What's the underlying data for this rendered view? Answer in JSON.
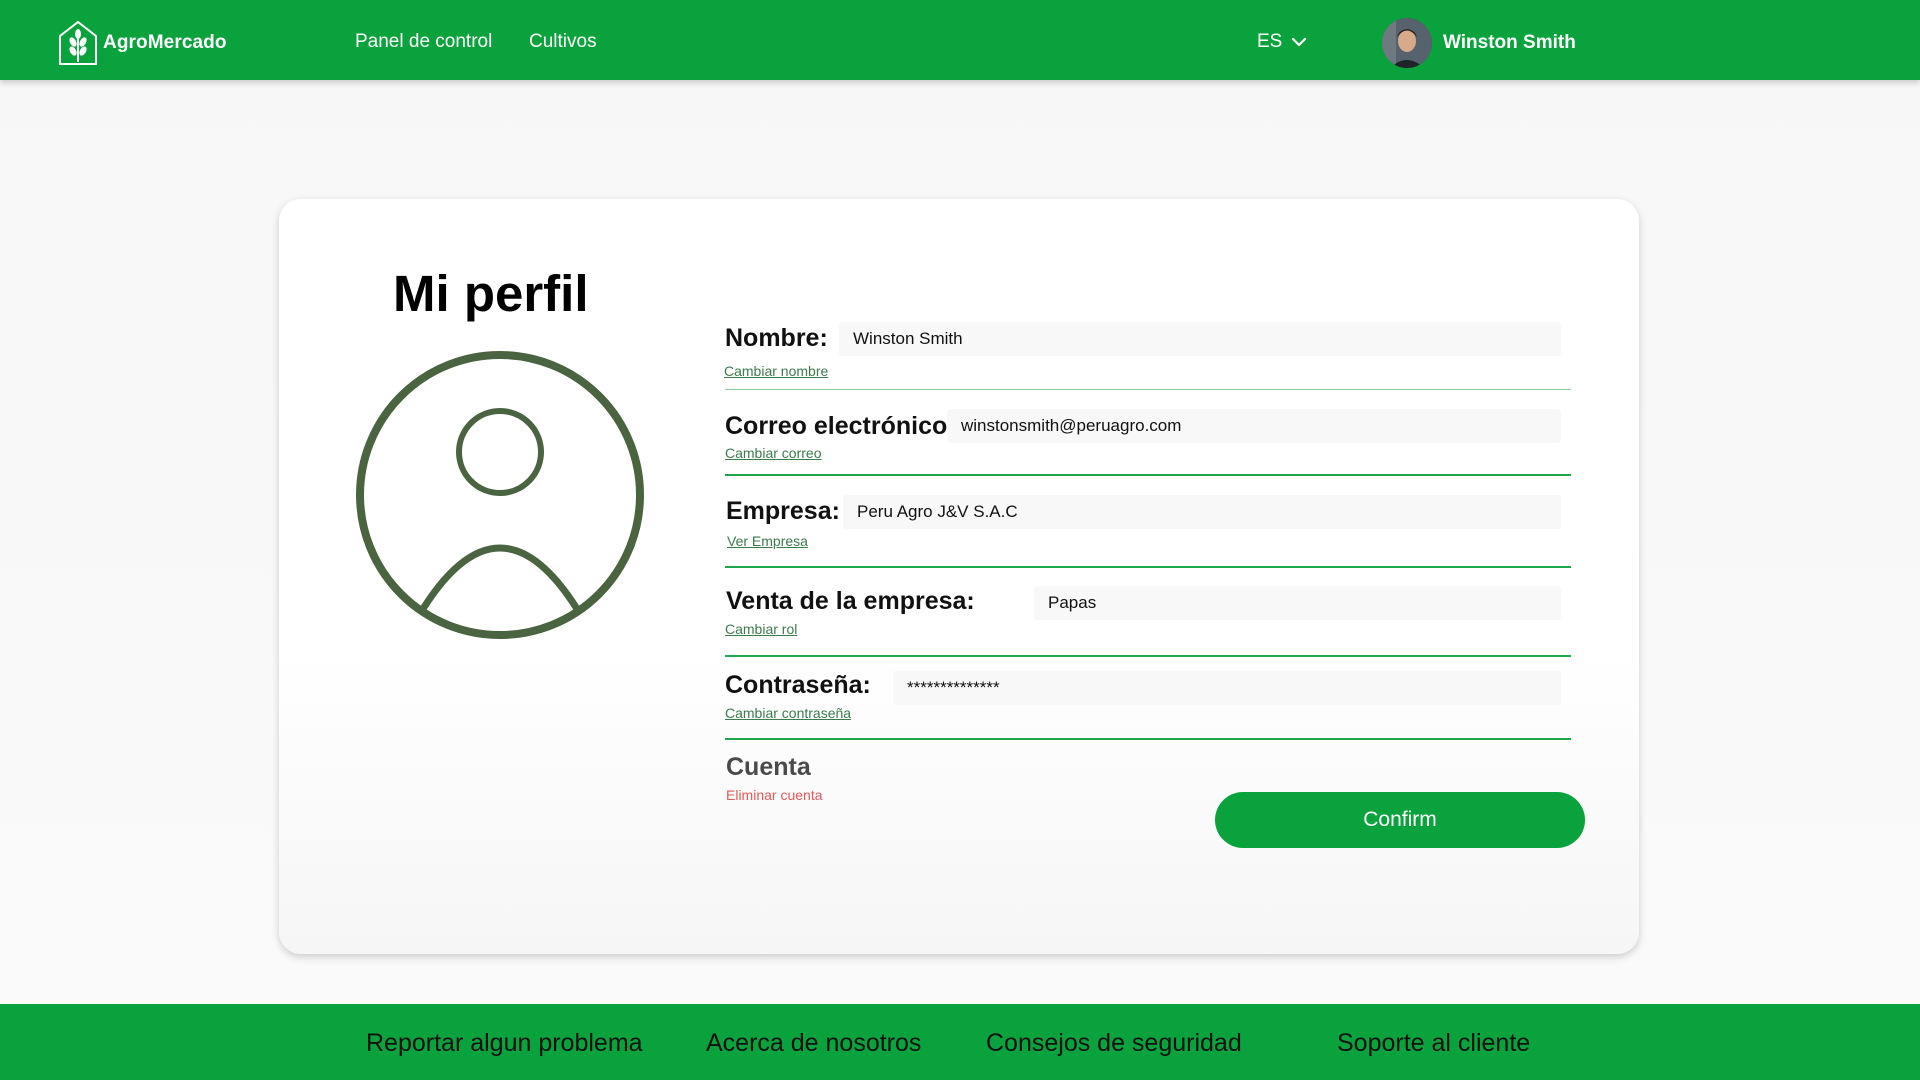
{
  "header": {
    "brand": "AgroMercado",
    "nav": [
      "Panel de control",
      "Cultivos"
    ],
    "language": "ES",
    "user_name": "Winston Smith"
  },
  "profile": {
    "title": "Mi perfil",
    "fields": {
      "name": {
        "label": "Nombre:",
        "value": "Winston Smith",
        "link": "Cambiar nombre"
      },
      "email": {
        "label": "Correo electrónico:",
        "value": "winstonsmith@peruagro.com",
        "link": "Cambiar correo"
      },
      "company": {
        "label": "Empresa:",
        "value": "Peru Agro J&V S.A.C",
        "link": "Ver Empresa"
      },
      "sales": {
        "label": "Venta de la empresa:",
        "value": "Papas",
        "link": "Cambiar rol"
      },
      "password": {
        "label": "Contraseña:",
        "value": "**************",
        "link": "Cambiar contraseña"
      }
    },
    "account": {
      "title": "Cuenta",
      "delete_link": "Eliminar cuenta"
    },
    "confirm_label": "Confirm"
  },
  "footer": {
    "links": [
      "Reportar algun problema",
      "Acerca de nosotros",
      "Consejos de seguridad",
      "Soporte al cliente"
    ]
  },
  "colors": {
    "brand_green": "#0aa23c",
    "profile_icon": "#4a6441",
    "link_green": "#3d7a4c",
    "danger": "#e05a5a"
  }
}
